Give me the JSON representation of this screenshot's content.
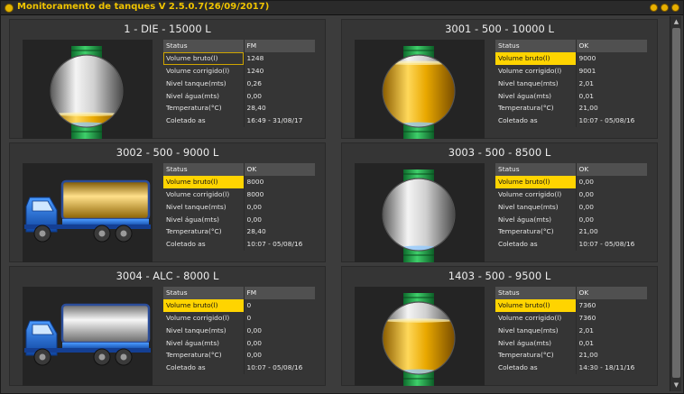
{
  "window": {
    "title": "Monitoramento de tanques V 2.5.0.7(26/09/2017)"
  },
  "labels": {
    "status": "Status",
    "volume_bruto": "Volume bruto(l)",
    "volume_corrigido": "Volume corrigido(l)",
    "nivel_tanque": "Nivel tanque(mts)",
    "nivel_agua": "Nivel água(mts)",
    "temperatura": "Temperatura(°C)",
    "coletado": "Coletado as"
  },
  "colors": {
    "accent": "#ffd400",
    "green": "#22a04a",
    "blue": "#1b63c8",
    "amber": "#e8a100"
  },
  "tanks": [
    {
      "title": "1 - DIE - 15000 L",
      "status": "FM",
      "volume_bruto": "1248",
      "volume_corrigido": "1240",
      "nivel_tanque": "0,26",
      "nivel_agua": "0,00",
      "temperatura": "28,40",
      "coletado": "16:49 - 31/08/17",
      "fill_fraction": 0.17,
      "icon": "vertical-tank-icon"
    },
    {
      "title": "3001 - 500 - 10000 L",
      "status": "OK",
      "volume_bruto": "9000",
      "volume_corrigido": "9001",
      "nivel_tanque": "2,01",
      "nivel_agua": "0,01",
      "temperatura": "21,00",
      "coletado": "10:07 - 05/08/16",
      "fill_fraction": 0.9,
      "icon": "vertical-tank-icon"
    },
    {
      "title": "3002 - 500 - 9000 L",
      "status": "OK",
      "volume_bruto": "8000",
      "volume_corrigido": "8000",
      "nivel_tanque": "0,00",
      "nivel_agua": "0,00",
      "temperatura": "28,40",
      "coletado": "10:07 - 05/08/16",
      "fill_fraction": 1.0,
      "icon": "truck-tank-icon"
    },
    {
      "title": "3003 - 500 - 8500 L",
      "status": "OK",
      "volume_bruto": "0,00",
      "volume_corrigido": "0,00",
      "nivel_tanque": "0,00",
      "nivel_agua": "0,00",
      "temperatura": "21,00",
      "coletado": "10:07 - 05/08/16",
      "fill_fraction": 0.0,
      "icon": "vertical-tank-icon"
    },
    {
      "title": "3004 - ALC - 8000 L",
      "status": "FM",
      "volume_bruto": "0",
      "volume_corrigido": "0",
      "nivel_tanque": "0,00",
      "nivel_agua": "0,00",
      "temperatura": "0,00",
      "coletado": "10:07 - 05/08/16",
      "fill_fraction": 0.0,
      "icon": "truck-tank-icon"
    },
    {
      "title": "1403 - 500 - 9500 L",
      "status": "OK",
      "volume_bruto": "7360",
      "volume_corrigido": "7360",
      "nivel_tanque": "2,01",
      "nivel_agua": "0,01",
      "temperatura": "21,00",
      "coletado": "14:30 - 18/11/16",
      "fill_fraction": 0.75,
      "icon": "vertical-tank-icon"
    }
  ]
}
